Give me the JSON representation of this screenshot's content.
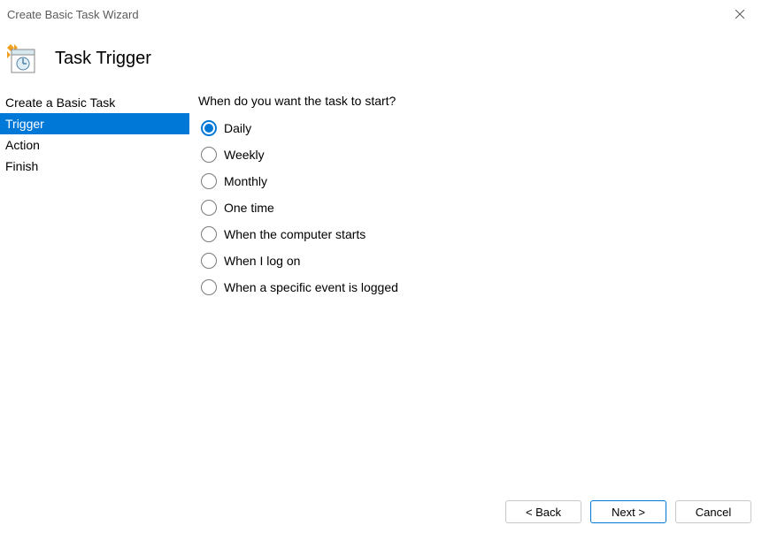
{
  "window": {
    "title": "Create Basic Task Wizard"
  },
  "header": {
    "title": "Task Trigger"
  },
  "sidebar": {
    "items": [
      {
        "label": "Create a Basic Task",
        "active": false
      },
      {
        "label": "Trigger",
        "active": true
      },
      {
        "label": "Action",
        "active": false
      },
      {
        "label": "Finish",
        "active": false
      }
    ]
  },
  "main": {
    "question": "When do you want the task to start?",
    "options": [
      {
        "label": "Daily",
        "selected": true
      },
      {
        "label": "Weekly",
        "selected": false
      },
      {
        "label": "Monthly",
        "selected": false
      },
      {
        "label": "One time",
        "selected": false
      },
      {
        "label": "When the computer starts",
        "selected": false
      },
      {
        "label": "When I log on",
        "selected": false
      },
      {
        "label": "When a specific event is logged",
        "selected": false
      }
    ]
  },
  "footer": {
    "back_label": "< Back",
    "next_label": "Next >",
    "cancel_label": "Cancel"
  }
}
